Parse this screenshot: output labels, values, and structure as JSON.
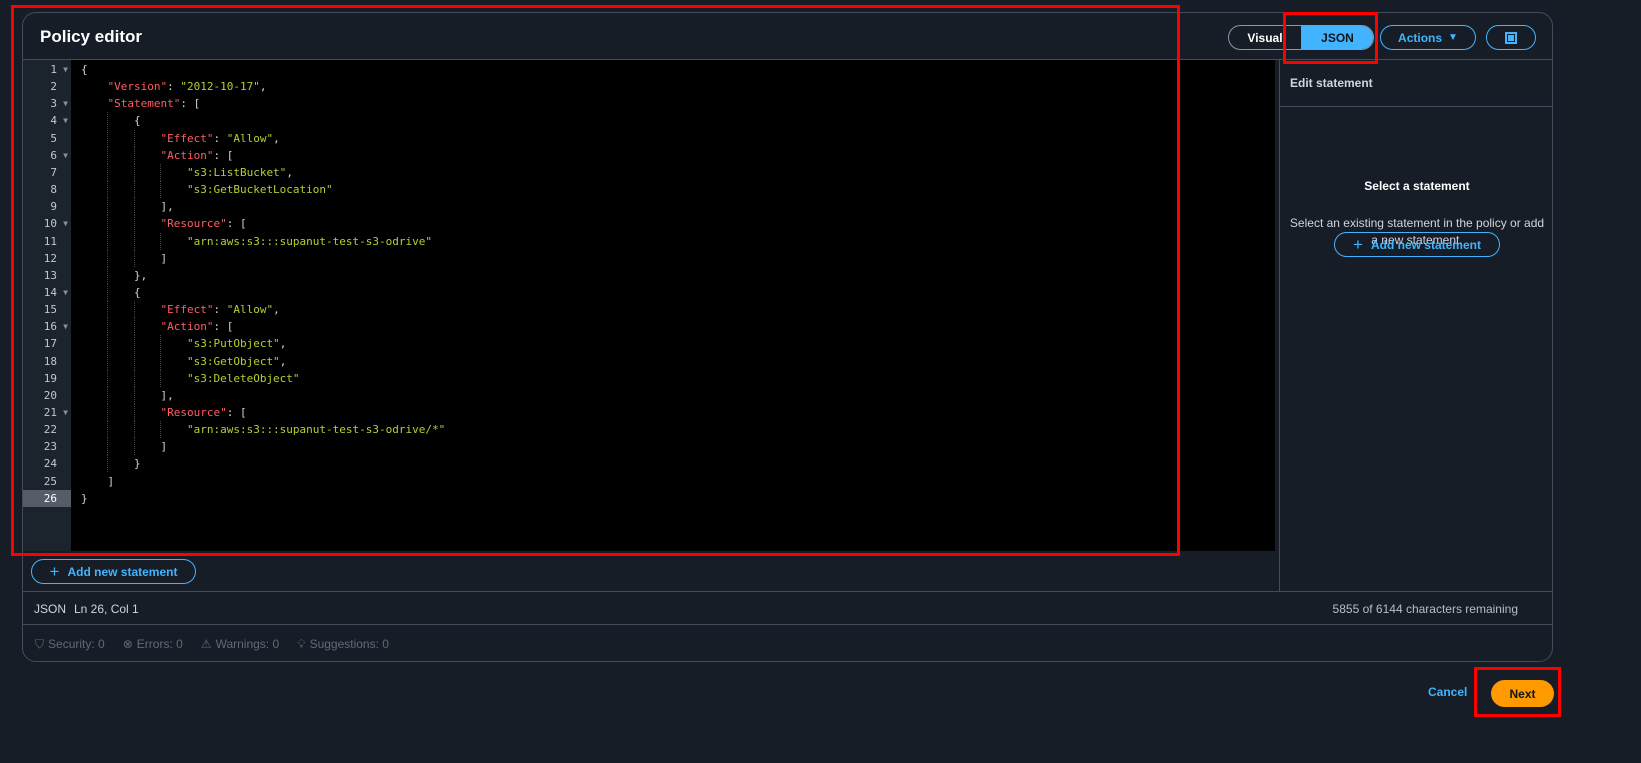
{
  "header": {
    "title": "Policy editor",
    "mode_visual": "Visual",
    "mode_json": "JSON",
    "actions_label": "Actions"
  },
  "editor": {
    "lines": [
      "{",
      "    \"Version\": \"2012-10-17\",",
      "    \"Statement\": [",
      "        {",
      "            \"Effect\": \"Allow\",",
      "            \"Action\": [",
      "                \"s3:ListBucket\",",
      "                \"s3:GetBucketLocation\"",
      "            ],",
      "            \"Resource\": [",
      "                \"arn:aws:s3:::supanut-test-s3-odrive\"",
      "            ]",
      "        },",
      "        {",
      "            \"Effect\": \"Allow\",",
      "            \"Action\": [",
      "                \"s3:PutObject\",",
      "                \"s3:GetObject\",",
      "                \"s3:DeleteObject\"",
      "            ],",
      "            \"Resource\": [",
      "                \"arn:aws:s3:::supanut-test-s3-odrive/*\"",
      "            ]",
      "        }",
      "    ]",
      "}"
    ],
    "foldable_lines": [
      1,
      3,
      4,
      6,
      10,
      14,
      16,
      21
    ],
    "active_line": 26
  },
  "side_panel": {
    "title": "Edit statement",
    "empty_title": "Select a statement",
    "empty_desc": "Select an existing statement in the policy or add a new statement.",
    "add_label": "Add new statement"
  },
  "add_statement_label": "Add new statement",
  "status": {
    "mode": "JSON",
    "position": "Ln 26, Col 1",
    "remaining": "5855 of 6144 characters remaining"
  },
  "footer": {
    "security": "Security: 0",
    "errors": "Errors: 0",
    "warnings": "Warnings: 0",
    "suggestions": "Suggestions: 0"
  },
  "buttons": {
    "cancel": "Cancel",
    "next": "Next"
  },
  "colors": {
    "accent": "#42b4ff",
    "primary": "#ff9900",
    "annotation": "#ff0000",
    "json_key": "#ff5d64",
    "json_string": "#b2d12f"
  }
}
